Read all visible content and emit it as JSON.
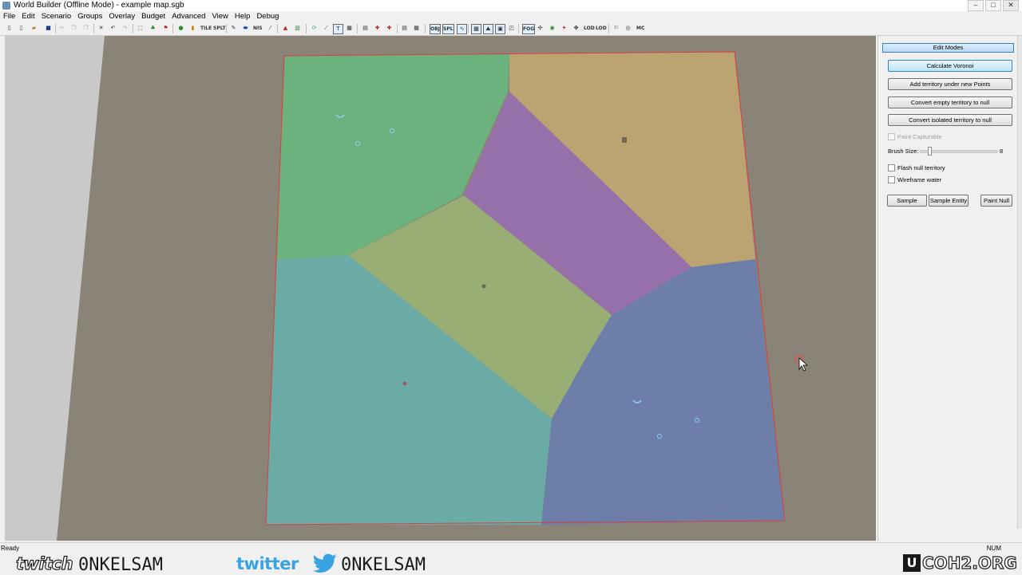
{
  "window": {
    "title": "World Builder (Offline Mode) - example map.sgb",
    "minimize": "–",
    "maximize": "□",
    "close": "✕"
  },
  "menu": [
    "File",
    "Edit",
    "Scenario",
    "Groups",
    "Overlay",
    "Budget",
    "Advanced",
    "View",
    "Help",
    "Debug"
  ],
  "toolbar": {
    "labels": [
      "TILE",
      "SPLT",
      "NIS",
      "OBJ",
      "SPL",
      "FOG",
      "LOD",
      "LOD",
      "MC"
    ]
  },
  "panel": {
    "header": "Edit Modes",
    "buttons": {
      "calculate_voronoi": "Calculate Voronoi",
      "add_territory": "Add territory under new Points",
      "convert_empty": "Convert empty territory to null",
      "convert_isolated": "Convert isolated territory to null"
    },
    "paint_capturable": "Paint Capturable",
    "brush_size_label": "Brush Size:",
    "brush_size_value": "8",
    "flash_null": "Flash null territory",
    "wireframe_water": "Wireframe water",
    "sample": "Sample",
    "sample_entity": "Sample Entity",
    "paint_null": "Paint Null"
  },
  "map": {
    "territory_colors": {
      "northwest": "#6cb27e",
      "northeast": "#bba472",
      "center_purple": "#9671a9",
      "center_olive": "#98ae75",
      "southwest": "#6aaba5",
      "southeast": "#6d7fa9"
    },
    "border_color": "#e03c3c",
    "terrain_color": "#8a8478"
  },
  "status": {
    "left": "Ready",
    "right": "NUM"
  },
  "stream_overlay": {
    "twitch_logo": "twitch",
    "twitch_handle": "0NKELSAM",
    "twitter_logo": "twitter",
    "twitter_handle": "0NKELSAM",
    "coh_logo": "COH2.ORG",
    "coh_box": "U"
  }
}
